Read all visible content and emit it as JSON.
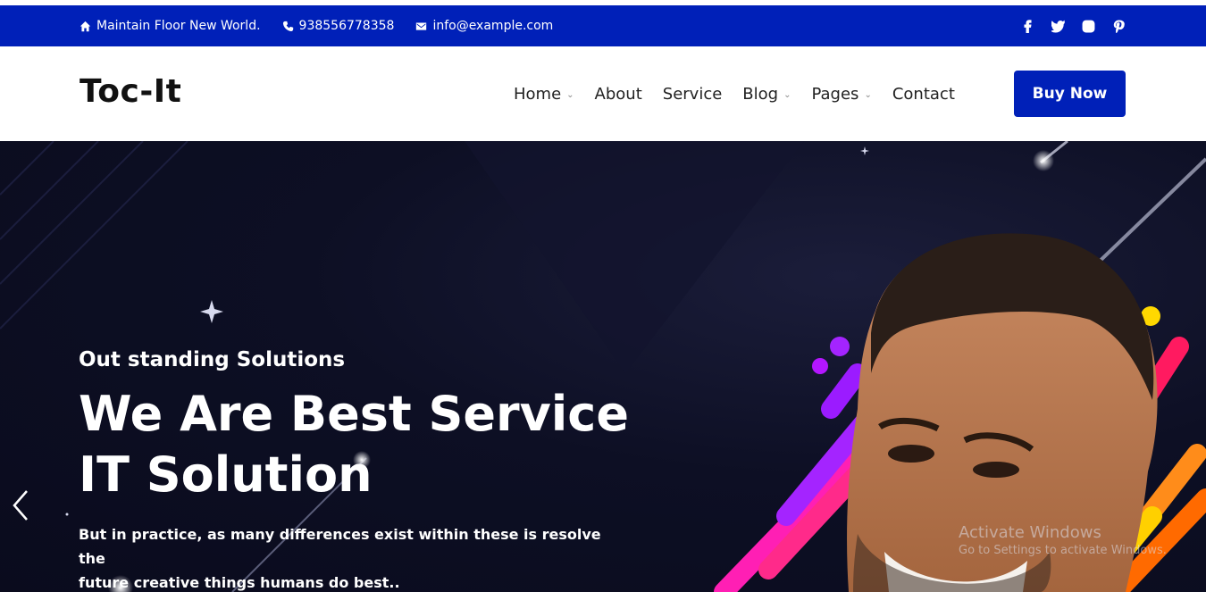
{
  "topbar": {
    "address": "Maintain Floor New World.",
    "phone": "938556778358",
    "email": "info@example.com",
    "social": [
      "facebook-icon",
      "twitter-icon",
      "instagram-icon",
      "pinterest-icon"
    ]
  },
  "header": {
    "logo": "Toc-It",
    "nav": [
      {
        "label": "Home",
        "dropdown": true
      },
      {
        "label": "About",
        "dropdown": false
      },
      {
        "label": "Service",
        "dropdown": false
      },
      {
        "label": "Blog",
        "dropdown": true
      },
      {
        "label": "Pages",
        "dropdown": true
      },
      {
        "label": "Contact",
        "dropdown": false
      }
    ],
    "cta": "Buy Now"
  },
  "hero": {
    "subtitle": "Out standing Solutions",
    "title_line1": "We Are Best Service",
    "title_line2": "IT Solution",
    "text_line1": "But in practice, as many differences exist within these is resolve the",
    "text_line2": "future creative things humans do best.."
  },
  "watermark": {
    "line1": "Activate Windows",
    "line2": "Go to Settings to activate Windows."
  },
  "colors": {
    "brand": "#0020b8",
    "hero_bg": "#0d0f24",
    "text": "#222222"
  }
}
